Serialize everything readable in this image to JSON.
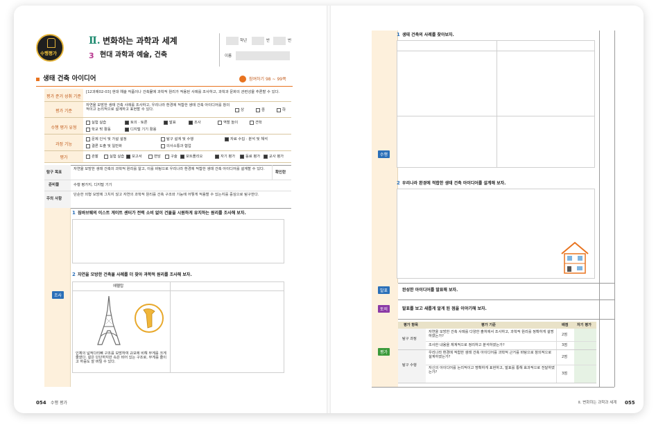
{
  "left": {
    "logo_text": "수행평가",
    "unit_numeral": "Ⅱ.",
    "unit_title": "변화하는 과학과 세계",
    "sub_num": "3",
    "sub_title": "현대 과학과 예술, 건축",
    "grade_label": "학년",
    "class_label": "반",
    "number_label": "번",
    "name_label": "이름",
    "section_title": "생태 건축 아이디어",
    "ref_text": "참여하기 98 ~ 99쪽",
    "rows": {
      "std_label": "평가 준거 성취 기준",
      "std_text": "[12과제02-03] 현대 예술 작품이나 건축물에 과학적 원리가 적용된 사례를 조사하고, 과학과 문화의 관련성을 추론할 수 있다.",
      "crit_label": "평가 기준",
      "crit_text": "자연을 모방한 생태 건축 사례를 조사하고, 우리나라 환경에 적합한 생태 건축 아이디어를 창의적이고 논리적으로 설계하고 표현할 수 있다.",
      "levels": [
        "상",
        "중",
        "하"
      ],
      "type_label": "수행 평가 유형",
      "types": [
        {
          "label": "실험 실습",
          "on": false
        },
        {
          "label": "토의 · 토론",
          "on": true
        },
        {
          "label": "발표",
          "on": true
        },
        {
          "label": "조사",
          "on": true
        },
        {
          "label": "역할 놀이",
          "on": false
        },
        {
          "label": "견학",
          "on": false
        },
        {
          "label": "학교 밖 활동",
          "on": false
        },
        {
          "label": "디지털 기기 활용",
          "on": true
        }
      ],
      "skill_label": "과정 기능",
      "skills": [
        {
          "label": "문제 인식 및 가설 설정",
          "on": false
        },
        {
          "label": "탐구 설계 및 수행",
          "on": false
        },
        {
          "label": "자료 수집 · 분석 및 해석",
          "on": true
        },
        {
          "label": "결론 도출 및 일반화",
          "on": false
        },
        {
          "label": "의사소통과 협업",
          "on": false
        }
      ],
      "eval_label": "평가",
      "evals": [
        {
          "label": "관찰",
          "on": false
        },
        {
          "label": "실험 실습",
          "on": false
        },
        {
          "label": "보고서",
          "on": true
        },
        {
          "label": "면담",
          "on": false
        },
        {
          "label": "구술",
          "on": false
        },
        {
          "label": "포트폴리오",
          "on": true
        },
        {
          "label": "자기 평가",
          "on": true
        },
        {
          "label": "동료 평가",
          "on": true
        },
        {
          "label": "교사 평가",
          "on": true
        }
      ],
      "goal_label": "탐구 목표",
      "goal_text": "자연을 모방한 생태 건축의 과학적 원리를 알고, 이를 바탕으로 우리나라 환경에 적합한 생태 건축 아이디어를 설계할 수 있다.",
      "check_label": "확인란",
      "prep_label": "준비물",
      "prep_text": "수행 평가지, 디지털 기기",
      "note_label": "주의 사항",
      "note_text": "단순한 외형 모방에 그치지 않고 자연의 과학적 원리를 건축 구조와 기능에 어떻게 적용할 수 있는지를 중심으로 탐구한다."
    },
    "investigate_tag": "조사",
    "q1_num": "1",
    "q1_text": "짐바브웨의 이스트 게이트 센터가 전력 소비 없이 건물을 시원하게 유지하는 원리를 조사해 보자.",
    "q2_num": "2",
    "q2_text": "자연을 모방한 건축물 사례를 더 찾아 과학적 원리를 조사해 보자.",
    "q2_col1": "에펠탑",
    "q2_caption": "인체의 넓적다리뼈 구조를 모방하여 규모에 비해 무게를 크게 줄였다. 겉은 단단하지만 속은 비어 있는 구조로, 무게를 줄이고 하중도 잘 버틸 수 있다.",
    "footer_page": "054",
    "footer_label": "수행 평가"
  },
  "right": {
    "q1_num": "1",
    "q1_text": "생태 건축의 사례를 찾아보자.",
    "q2_num": "2",
    "q2_text": "우리나라 환경에 적합한 생태 건축 아이디어를 설계해 보자.",
    "perform_tag": "수행",
    "present_tag": "발표",
    "present_text": "완성한 아이디어를 발표해 보자.",
    "discuss_tag": "토의",
    "discuss_text": "발표를 보고 새롭게 알게 된 점을 이야기해 보자.",
    "eval_tag": "평가",
    "table_head": [
      "평가 항목",
      "평가 기준",
      "배점",
      "자기 평가"
    ],
    "table_rows": [
      {
        "item": "탐구 과정",
        "crit": "자연을 모방한 건축 사례를 다양한 출처에서 조사하고, 과학적 원리를 정확하게 설명하였는가?",
        "score": "2점"
      },
      {
        "item": "",
        "crit": "조사한 내용을 체계적으로 정리하고 분석하였는가?",
        "score": "3점"
      },
      {
        "item": "탐구 수행",
        "crit": "우리나라 환경에 적합한 생태 건축 아이디어를 과학적 근거를 바탕으로 창의적으로 설계하였는가?",
        "score": "2점"
      },
      {
        "item": "",
        "crit": "자신의 아이디어를 논리적이고 명확하게 표현하고, 발표를 통해 효과적으로 전달하였는가?",
        "score": "3점"
      }
    ],
    "footer_label": "Ⅱ. 변화하는 과학과 세계",
    "footer_page": "055"
  },
  "colors": {
    "orange": "#e8731f",
    "tan": "#fdf0dc",
    "blue": "#2a6fb8",
    "purple": "#8b3aa6",
    "green": "#3b9a3b"
  }
}
